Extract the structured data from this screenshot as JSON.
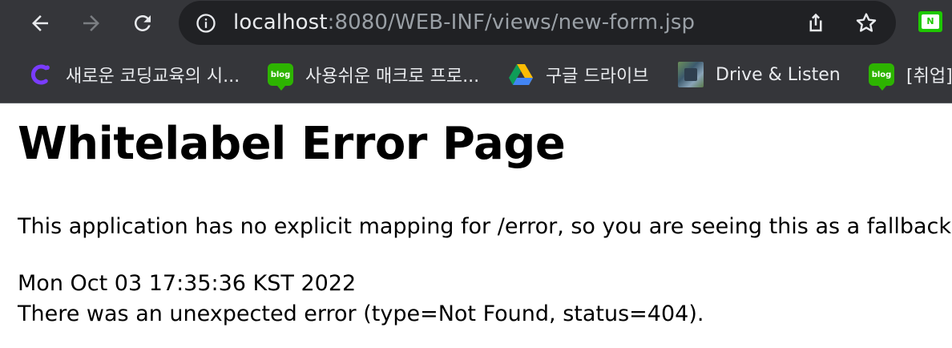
{
  "toolbar": {
    "url_host": "localhost",
    "url_rest": ":8080/WEB-INF/views/new-form.jsp",
    "extension_label": "N"
  },
  "bookmarks": [
    {
      "label": "새로운 코딩교육의 시...",
      "icon": "coding-logo-icon"
    },
    {
      "label": "사용쉬운 매크로 프로...",
      "icon": "blog-icon",
      "badge": "blog"
    },
    {
      "label": "구글 드라이브",
      "icon": "google-drive-icon"
    },
    {
      "label": "Drive & Listen",
      "icon": "drive-listen-icon"
    },
    {
      "label": "[취업]",
      "icon": "blog-icon",
      "badge": "blog"
    }
  ],
  "page": {
    "title": "Whitelabel Error Page",
    "message": "This application has no explicit mapping for /error, so you are seeing this as a fallback.",
    "timestamp": "Mon Oct 03 17:35:36 KST 2022",
    "detail": "There was an unexpected error (type=Not Found, status=404)."
  },
  "colors": {
    "chrome_bg": "#35363a",
    "omnibox_bg": "#202124",
    "blog_green": "#2db400",
    "naver_green": "#1ec800"
  }
}
